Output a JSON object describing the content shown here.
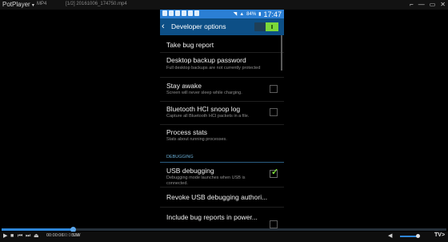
{
  "player": {
    "app_name": "PotPlayer",
    "menu_arrow": "▾",
    "format_tag": "MP4",
    "file_name": "[1/2] 20161006_174750.mp4",
    "window_controls": [
      "⌐",
      "―",
      "▭",
      "✕"
    ],
    "current_time": "00:00:06",
    "total_time": "00:00:36",
    "sw_label": "S/W",
    "brand": "TV>",
    "seek_progress": 0.16,
    "volume_level": 0.95,
    "accent_color": "#2f86d8"
  },
  "phone": {
    "status_bar": {
      "time": "17:47",
      "battery": "84%",
      "color": "#2b7fd4"
    },
    "app_bar": {
      "title": "Developer options",
      "color": "#0d4f86",
      "toggle_on": true
    },
    "settings": [
      {
        "title": "Take bug report",
        "subtitle": "",
        "checkbox": null
      },
      {
        "title": "Desktop backup password",
        "subtitle": "Full desktop backups are not currently protected",
        "checkbox": null
      },
      {
        "title": "Stay awake",
        "subtitle": "Screen will never sleep while charging.",
        "checkbox": false
      },
      {
        "title": "Bluetooth HCI snoop log",
        "subtitle": "Capture all Bluetooth HCI packets in a file.",
        "checkbox": false
      },
      {
        "title": "Process stats",
        "subtitle": "Stats about running processes.",
        "checkbox": null
      }
    ],
    "section_header": "DEBUGGING",
    "debug_settings": [
      {
        "title": "USB debugging",
        "subtitle": "Debugging mode launches when USB is connected.",
        "checkbox": true
      },
      {
        "title": "Revoke USB debugging authori...",
        "subtitle": "",
        "checkbox": null
      },
      {
        "title": "Include bug reports in power...",
        "subtitle": "",
        "checkbox": null
      }
    ],
    "check_color": "#7bd93a"
  }
}
